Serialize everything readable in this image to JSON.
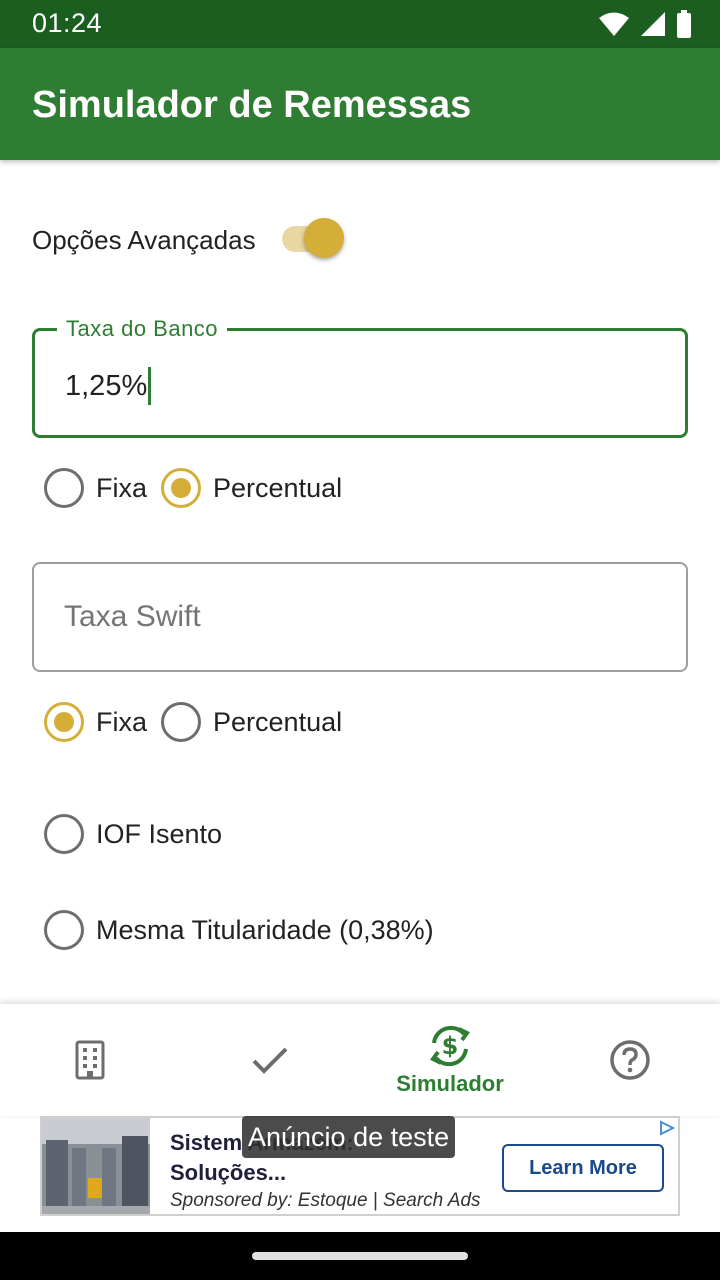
{
  "status_bar": {
    "time": "01:24",
    "icons": [
      "wifi-icon",
      "signal-icon",
      "battery-icon"
    ]
  },
  "app_bar": {
    "title": "Simulador de Remessas"
  },
  "advanced": {
    "label": "Opções Avançadas",
    "enabled": true
  },
  "bank_fee": {
    "label": "Taxa do Banco",
    "value": "1,25%",
    "type_options": [
      {
        "label": "Fixa",
        "selected": false
      },
      {
        "label": "Percentual",
        "selected": true
      }
    ]
  },
  "swift_fee": {
    "placeholder": "Taxa Swift",
    "value": "",
    "type_options": [
      {
        "label": "Fixa",
        "selected": true
      },
      {
        "label": "Percentual",
        "selected": false
      }
    ]
  },
  "iof_exempt": {
    "label": "IOF Isento",
    "selected": false
  },
  "same_ownership": {
    "label": "Mesma Titularidade (0,38%)",
    "selected": false
  },
  "bottom_nav": {
    "items": [
      {
        "icon": "building-icon",
        "label": "",
        "active": false
      },
      {
        "icon": "check-icon",
        "label": "",
        "active": false
      },
      {
        "icon": "currency-exchange-icon",
        "label": "Simulador",
        "active": true
      },
      {
        "icon": "help-icon",
        "label": "",
        "active": false
      }
    ]
  },
  "ad": {
    "test_label": "Anúncio de teste",
    "title": "Sistem Armazém: Soluções...",
    "sponsor": "Sponsored by: Estoque | Search Ads",
    "cta": "Learn More"
  },
  "colors": {
    "primary": "#2e7d32",
    "status_bar": "#1b5e20",
    "accent": "#d4ae38"
  }
}
